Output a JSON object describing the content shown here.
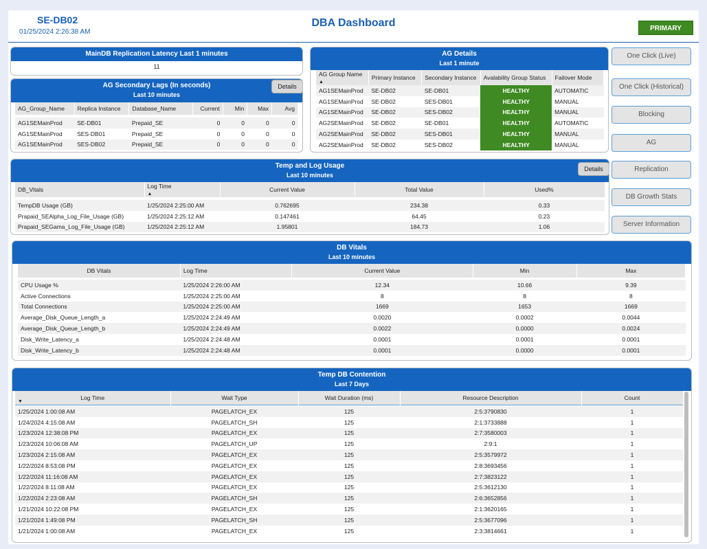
{
  "header": {
    "server": "SE-DB02",
    "timestamp": "01/25/2024  2:26:38 AM",
    "title": "DBA Dashboard",
    "role_badge": "PRIMARY",
    "colors": {
      "accent": "#1565c0",
      "healthy": "#3f8a22"
    }
  },
  "replication_latency": {
    "title": "MainDB Replication Latency Last 1 minutes",
    "value": "11"
  },
  "ag_lags": {
    "title": "AG Secondary Lags (In seconds)",
    "subtitle": "Last 10 minutes",
    "details_label": "Details",
    "columns": [
      "AG_Group_Name",
      "Replica Instance",
      "Database_Name",
      "Current",
      "Min",
      "Max",
      "Avg"
    ],
    "rows": [
      [
        "AG1SEMainProd",
        "SE-DB01",
        "Prepaid_SE",
        "0",
        "0",
        "0",
        "0"
      ],
      [
        "AG1SEMainProd",
        "SES-DB01",
        "Prepaid_SE",
        "0",
        "0",
        "0",
        "0"
      ],
      [
        "AG1SEMainProd",
        "SES-DB02",
        "Prepaid_SE",
        "0",
        "0",
        "0",
        "0"
      ]
    ]
  },
  "ag_details": {
    "title": "AG Details",
    "subtitle": "Last 1 minute",
    "columns": [
      "AG Group Name",
      "Primary Instance",
      "Secondary Instance",
      "Avalability Group Status",
      "Failover Mode"
    ],
    "rows": [
      [
        "AG1SEMainProd",
        "SE-DB02",
        "SE-DB01",
        "HEALTHY",
        "AUTOMATIC"
      ],
      [
        "AG1SEMainProd",
        "SE-DB02",
        "SES-DB01",
        "HEALTHY",
        "MANUAL"
      ],
      [
        "AG1SEMainProd",
        "SE-DB02",
        "SES-DB02",
        "HEALTHY",
        "MANUAL"
      ],
      [
        "AG2SEMainProd",
        "SE-DB02",
        "SE-DB01",
        "HEALTHY",
        "AUTOMATIC"
      ],
      [
        "AG2SEMainProd",
        "SE-DB02",
        "SES-DB01",
        "HEALTHY",
        "MANUAL"
      ],
      [
        "AG2SEMainProd",
        "SE-DB02",
        "SES-DB02",
        "HEALTHY",
        "MANUAL"
      ]
    ]
  },
  "temp_log": {
    "title": "Temp and Log Usage",
    "subtitle": "Last 10 minutes",
    "details_label": "Details",
    "columns": [
      "DB_Vitals",
      "Log Time",
      "Current Value",
      "Total Value",
      "Used%"
    ],
    "rows": [
      [
        "TempDB Usage (GB)",
        "1/25/2024 2:25:00 AM",
        "0.762695",
        "234.38",
        "0.33"
      ],
      [
        "Prapaid_SEAlpha_Log_File_Usage (GB)",
        "1/25/2024 2:25:12 AM",
        "0.147461",
        "64.45",
        "0.23"
      ],
      [
        "Prapaid_SEGama_Log_File_Usage (GB)",
        "1/25/2024 2:25:12 AM",
        "1.95801",
        "184.73",
        "1.06"
      ]
    ]
  },
  "nav_buttons": [
    "One Click (Live)",
    "One Click (Historical)",
    "Blocking",
    "AG",
    "Replication",
    "DB Growth Stats",
    "Server Information"
  ],
  "db_vitals": {
    "title": "DB Vitals",
    "subtitle": "Last 10 minutes",
    "columns": [
      "DB Vitals",
      "Log Time",
      "Current Value",
      "Min",
      "Max"
    ],
    "rows": [
      [
        "CPU Usage %",
        "1/25/2024 2:26:00 AM",
        "12.34",
        "10.66",
        "9.39"
      ],
      [
        "Active Connections",
        "1/25/2024 2:25:00 AM",
        "8",
        "8",
        "8"
      ],
      [
        "Total Connections",
        "1/25/2024 2:25:00 AM",
        "1669",
        "1653",
        "1669"
      ],
      [
        "Average_Disk_Queue_Length_a",
        "1/25/2024 2:24:49 AM",
        "0.0020",
        "0.0002",
        "0.0044"
      ],
      [
        "Average_Disk_Queue_Length_b",
        "1/25/2024 2:24:49 AM",
        "0.0022",
        "0.0000",
        "0.0024"
      ],
      [
        "Disk_Write_Latency_a",
        "1/25/2024 2:24:48 AM",
        "0.0001",
        "0.0001",
        "0.0001"
      ],
      [
        "Disk_Write_Latency_b",
        "1/25/2024 2:24:48 AM",
        "0.0001",
        "0.0000",
        "0.0001"
      ]
    ]
  },
  "temp_db": {
    "title": "Temp DB Contention",
    "subtitle": "Last 7 Days",
    "columns": [
      "Log Time",
      "Wait Type",
      "Wait Duration (ms)",
      "Resource Description",
      "Count"
    ],
    "rows": [
      [
        "1/25/2024 1:00:08 AM",
        "PAGELATCH_EX",
        "125",
        "2:5:3790830",
        "1"
      ],
      [
        "1/24/2024 4:15:08 AM",
        "PAGELATCH_SH",
        "125",
        "2:1:3733888",
        "1"
      ],
      [
        "1/23/2024 12:38:08 PM",
        "PAGELATCH_EX",
        "125",
        "2:7:3580003",
        "1"
      ],
      [
        "1/23/2024 10:06:08 AM",
        "PAGELATCH_UP",
        "125",
        "2:9:1",
        "1"
      ],
      [
        "1/23/2024 2:15:08 AM",
        "PAGELATCH_EX",
        "125",
        "2:5:3579972",
        "1"
      ],
      [
        "1/22/2024 8:53:08 PM",
        "PAGELATCH_EX",
        "125",
        "2:8:3693456",
        "1"
      ],
      [
        "1/22/2024 11:16:08 AM",
        "PAGELATCH_EX",
        "125",
        "2:7:3823122",
        "1"
      ],
      [
        "1/22/2024 8:11:08 AM",
        "PAGELATCH_EX",
        "125",
        "2:5:3612130",
        "1"
      ],
      [
        "1/22/2024 2:23:08 AM",
        "PAGELATCH_SH",
        "125",
        "2:6:3652856",
        "1"
      ],
      [
        "1/21/2024 10:22:08 PM",
        "PAGELATCH_EX",
        "125",
        "2:1:3620165",
        "1"
      ],
      [
        "1/21/2024 1:49:08 PM",
        "PAGELATCH_SH",
        "125",
        "2:5:3677096",
        "1"
      ],
      [
        "1/21/2024 1:00:08 AM",
        "PAGELATCH_EX",
        "125",
        "2:3:3814661",
        "1"
      ]
    ]
  }
}
